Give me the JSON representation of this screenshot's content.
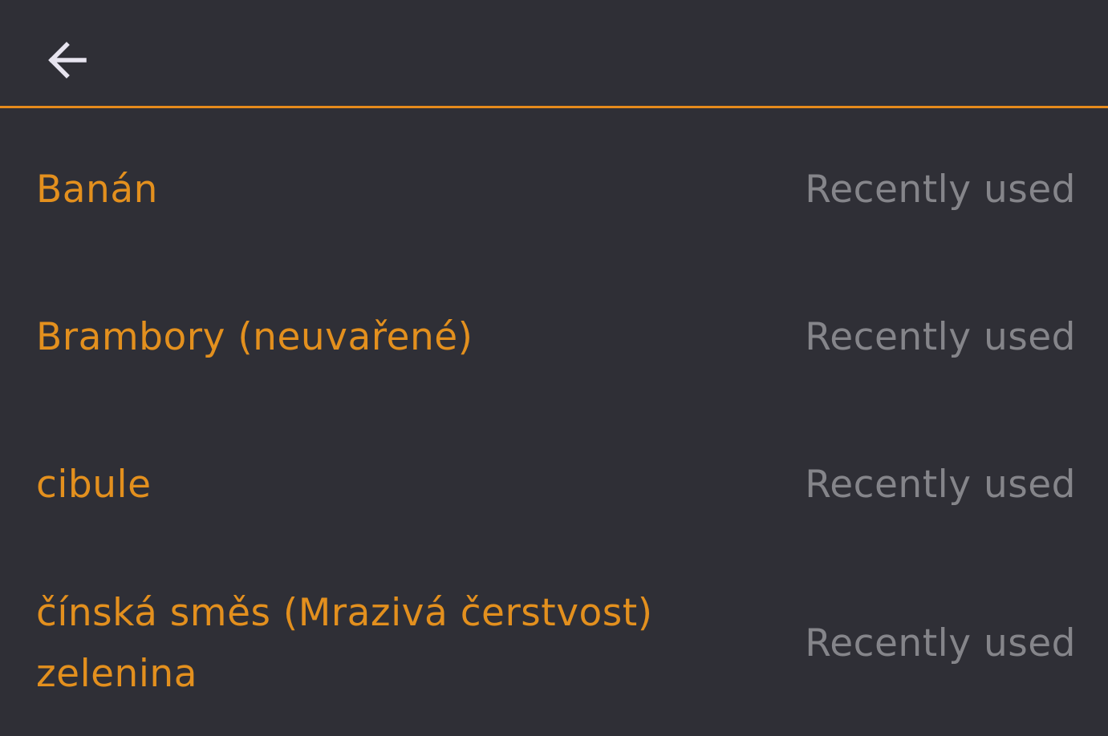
{
  "toolbar": {
    "back_icon": "arrow-left-icon",
    "accent_color": "#e68a1c"
  },
  "items": [
    {
      "name": "Banán",
      "status": "Recently used"
    },
    {
      "name": "Brambory (neuvařené)",
      "status": "Recently used"
    },
    {
      "name": "cibule",
      "status": "Recently used"
    },
    {
      "name": "čínská směs (Mrazivá čerstvost) zelenina",
      "status": "Recently used"
    }
  ],
  "colors": {
    "background": "#2f2f36",
    "item_name": "#e3901e",
    "status": "#85858a"
  }
}
